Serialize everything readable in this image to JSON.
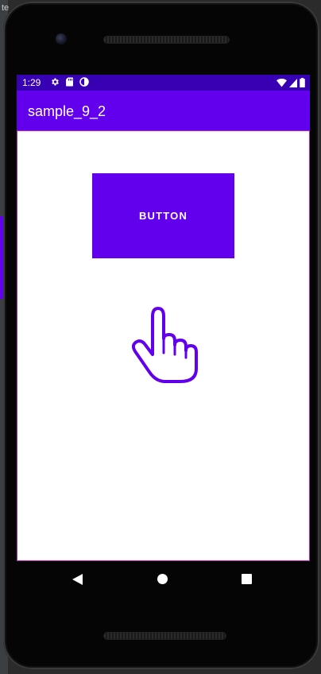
{
  "background": {
    "ide_text": "te"
  },
  "status_bar": {
    "time": "1:29",
    "icons_left": [
      "gear-icon",
      "sd-card-icon",
      "data-saver-icon"
    ],
    "icons_right": [
      "wifi-icon",
      "signal-icon",
      "battery-icon"
    ]
  },
  "app_bar": {
    "title": "sample_9_2"
  },
  "main": {
    "button_label": "BUTTON",
    "pointer_icon": "hand-pointer-icon"
  },
  "nav_bar": {
    "buttons": [
      "back",
      "home",
      "recents"
    ]
  },
  "colors": {
    "status_bar": "#3700b3",
    "primary": "#6200ee",
    "on_primary": "#ffffff"
  }
}
